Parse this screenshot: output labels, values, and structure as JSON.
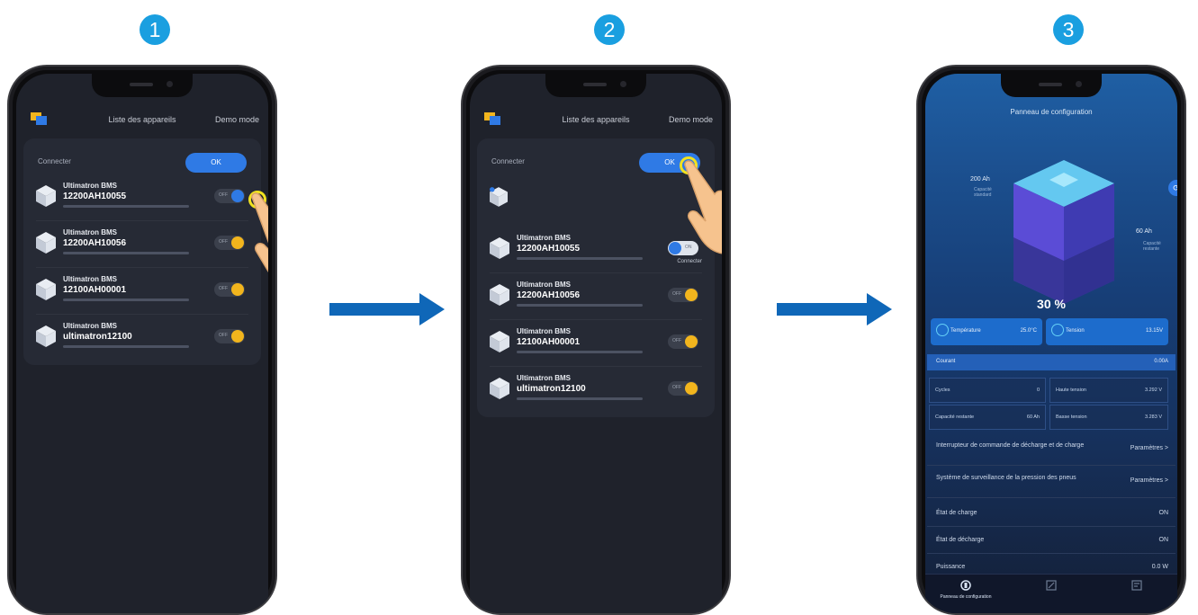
{
  "steps": [
    "1",
    "2",
    "3"
  ],
  "device_list": {
    "title": "Liste des appareils",
    "demo_mode": "Demo mode",
    "connect_label": "Connecter",
    "ok_label": "OK",
    "connected_sub": "Connecter",
    "devices": [
      {
        "line1": "Ultimatron BMS",
        "line2": "12200AH10055"
      },
      {
        "line1": "Ultimatron BMS",
        "line2": "12200AH10056"
      },
      {
        "line1": "Ultimatron BMS",
        "line2": "12100AH00001"
      },
      {
        "line1": "Ultimatron BMS",
        "line2": "ultimatron12100"
      }
    ]
  },
  "config": {
    "title": "Panneau de configuration",
    "capacity_standard_value": "200 Ah",
    "capacity_standard_label": "Capacité standard",
    "capacity_remaining_value": "60 Ah",
    "capacity_remaining_label": "Capacité restante",
    "soc_percent": "30 %",
    "temperature_label": "Température",
    "temperature_value": "25.0°C",
    "voltage_label": "Tension",
    "voltage_value": "13.15V",
    "current_label": "Courant",
    "current_value": "0.00A",
    "cycles_label": "Cycles",
    "cycles_value": "0",
    "high_voltage_label": "Haute tension",
    "high_voltage_value": "3.292 V",
    "remaining_label": "Capacité restante",
    "remaining_value": "60 Ah",
    "low_voltage_label": "Basse tension",
    "low_voltage_value": "3.283 V",
    "switch_label": "Interrupteur de commande de décharge et de charge",
    "switch_value": "Paramètres >",
    "tpms_label": "Système de surveillance de la pression des pneus",
    "tpms_value": "Paramètres >",
    "charge_state_label": "État de charge",
    "charge_state_value": "ON",
    "discharge_state_label": "État de décharge",
    "discharge_state_value": "ON",
    "power_label": "Puissance",
    "power_value": "0.0 W",
    "tabs": [
      "Panneau de configuration",
      "",
      ""
    ]
  },
  "colors": {
    "accent": "#2f7ae5",
    "arrow": "#0f67b8",
    "step": "#1a9fe0",
    "toggle_knob": "#f2b51d"
  }
}
